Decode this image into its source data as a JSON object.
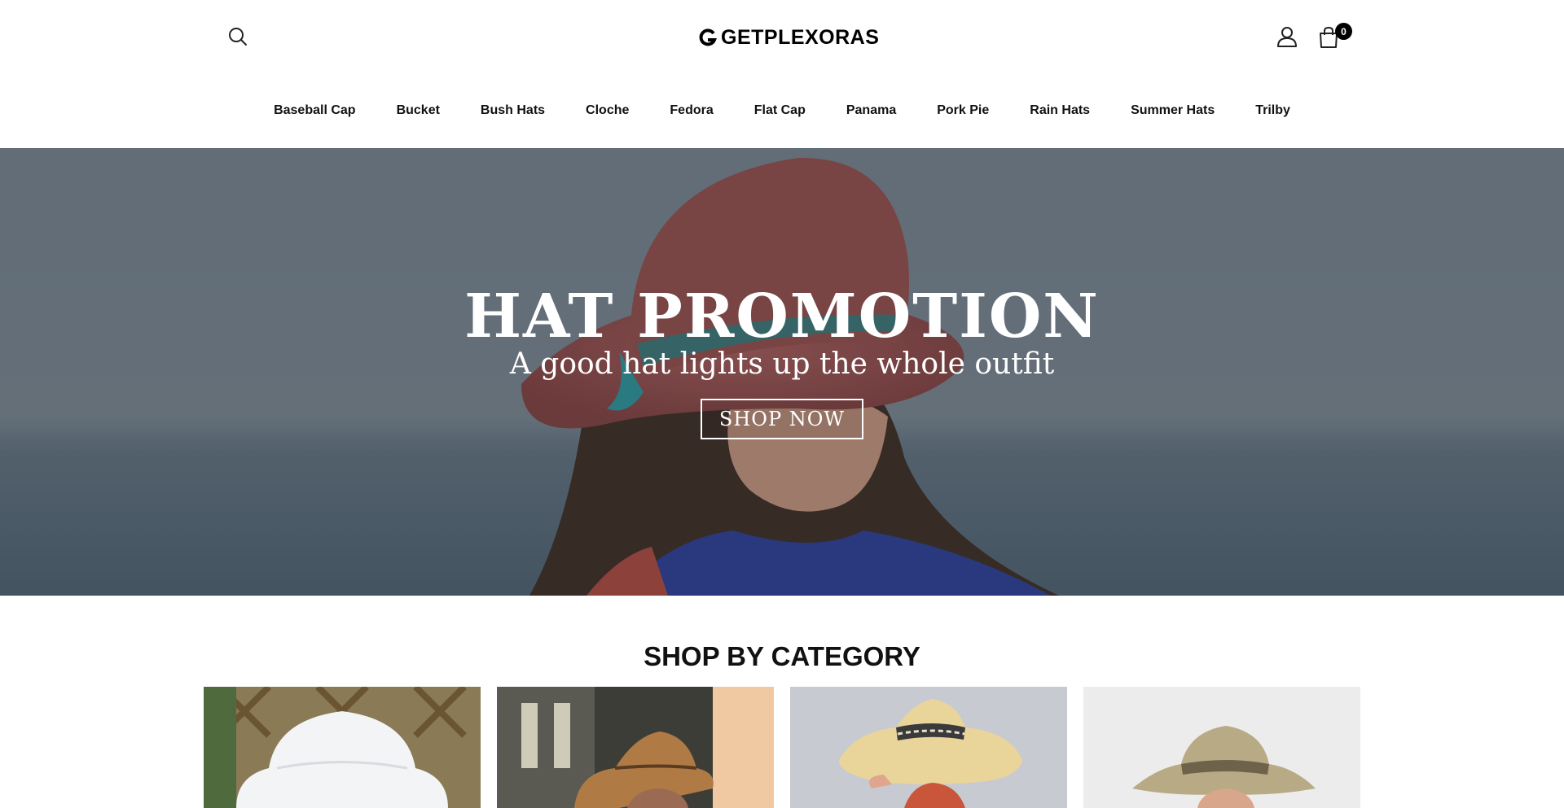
{
  "header": {
    "logo_text": "GETPLEXORAS",
    "cart_count": "0",
    "icons": [
      "search-icon",
      "logo-icon",
      "user-icon",
      "cart-icon"
    ]
  },
  "nav": {
    "items": [
      {
        "label": "Baseball Cap"
      },
      {
        "label": "Bucket"
      },
      {
        "label": "Bush Hats"
      },
      {
        "label": "Cloche"
      },
      {
        "label": "Fedora"
      },
      {
        "label": "Flat Cap"
      },
      {
        "label": "Panama"
      },
      {
        "label": "Pork Pie"
      },
      {
        "label": "Rain Hats"
      },
      {
        "label": "Summer Hats"
      },
      {
        "label": "Trilby"
      }
    ]
  },
  "hero": {
    "title": "HAT PROMOTION",
    "subtitle": "A good hat lights up the whole outfit",
    "cta_label": "SHOP NOW"
  },
  "categories": {
    "title": "SHOP BY CATEGORY"
  },
  "colors": {
    "accent": "#000000",
    "hero_bg": "#6c7780",
    "hat_red": "#8e4a47"
  }
}
